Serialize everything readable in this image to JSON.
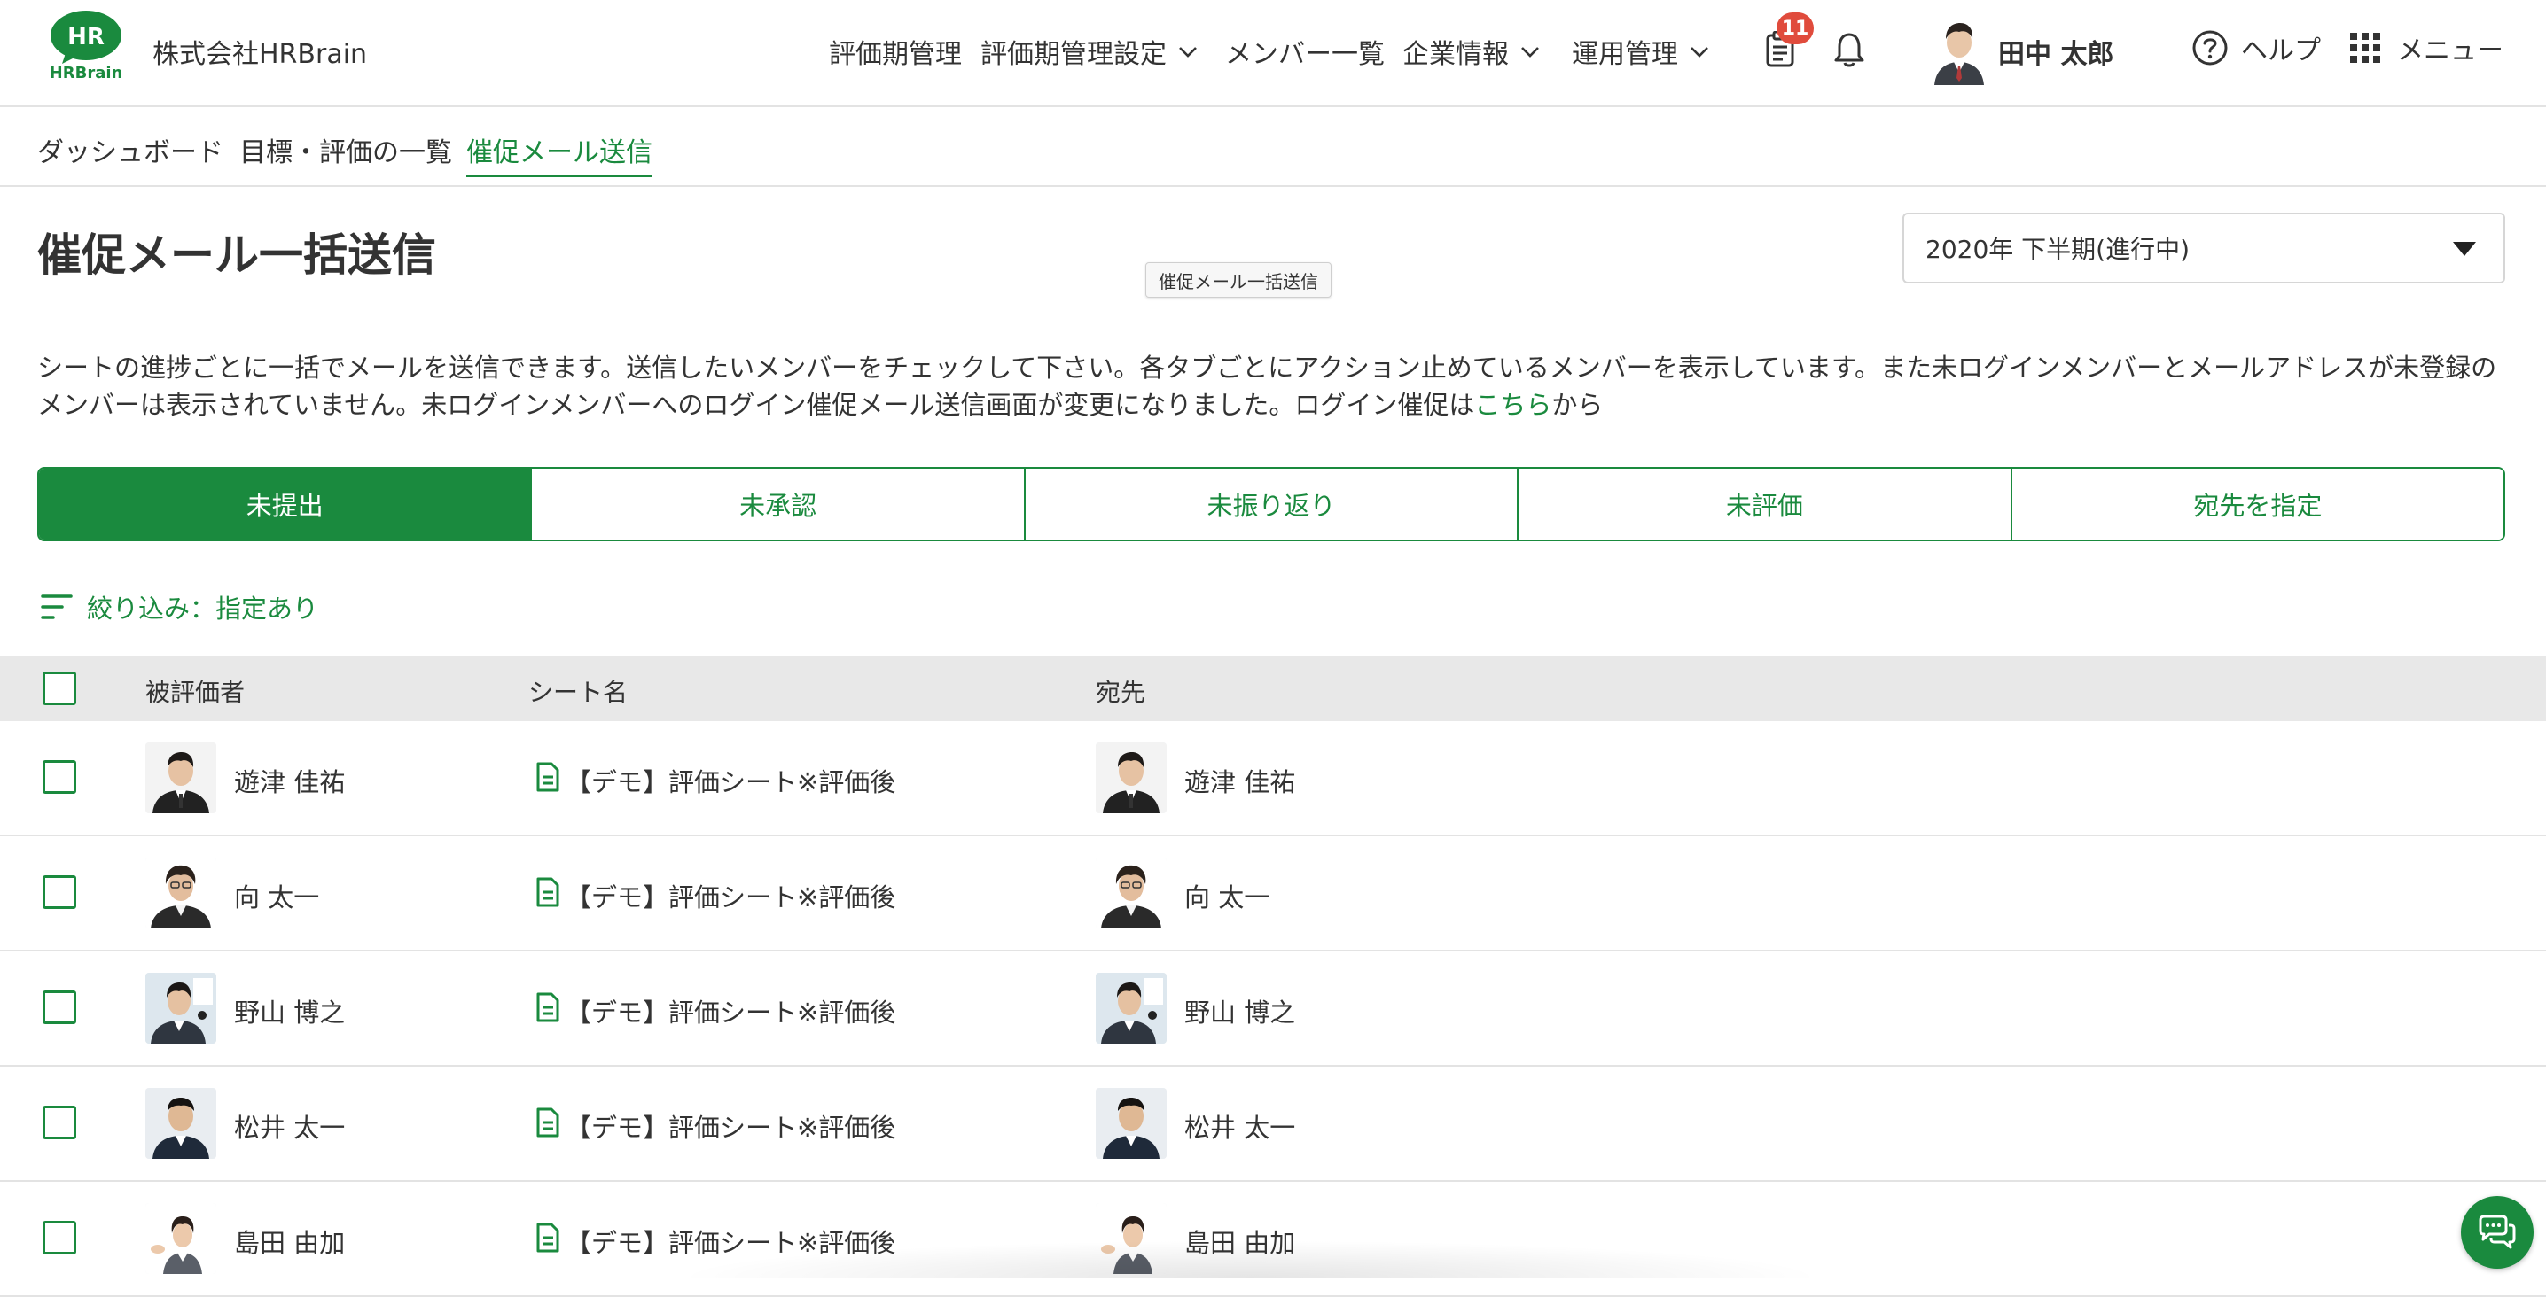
{
  "header": {
    "logo_text": "HR",
    "logo_subtext": "HRBrain",
    "company": "株式会社HRBrain",
    "nav": [
      {
        "label": "評価期管理",
        "dropdown": false
      },
      {
        "label": "評価期管理設定",
        "dropdown": true
      },
      {
        "label": "メンバー一覧",
        "dropdown": false
      },
      {
        "label": "企業情報",
        "dropdown": true
      },
      {
        "label": "運用管理",
        "dropdown": true
      }
    ],
    "notification_count": "11",
    "user_name": "田中 太郎",
    "help_label": "ヘルプ",
    "menu_label": "メニュー"
  },
  "subnav": [
    {
      "label": "ダッシュボード",
      "active": false
    },
    {
      "label": "目標・評価の一覧",
      "active": false
    },
    {
      "label": "催促メール送信",
      "active": true
    }
  ],
  "page": {
    "title": "催促メール一括送信",
    "tooltip": "催促メール一括送信",
    "period": "2020年 下半期(進行中)",
    "description": "シートの進捗ごとに一括でメールを送信できます。送信したいメンバーをチェックして下さい。各タブごとにアクション止めているメンバーを表示しています。また未ログインメンバーとメールアドレスが未登録のメンバーは表示されていません。未ログインメンバーへのログイン催促メール送信画面が変更になりました。ログイン催促は",
    "description_link": "こちら",
    "description_tail": "から"
  },
  "tabs": [
    {
      "label": "未提出",
      "active": true
    },
    {
      "label": "未承認",
      "active": false
    },
    {
      "label": "未振り返り",
      "active": false
    },
    {
      "label": "未評価",
      "active": false
    },
    {
      "label": "宛先を指定",
      "active": false
    }
  ],
  "filter_label": "絞り込み：指定あり",
  "table": {
    "headers": {
      "evaluatee": "被評価者",
      "sheet": "シート名",
      "recipient": "宛先"
    },
    "rows": [
      {
        "evaluatee": "遊津 佳祐",
        "sheet": "【デモ】評価シート※評価後",
        "recipient": "遊津 佳祐"
      },
      {
        "evaluatee": "向 太一",
        "sheet": "【デモ】評価シート※評価後",
        "recipient": "向 太一"
      },
      {
        "evaluatee": "野山 博之",
        "sheet": "【デモ】評価シート※評価後",
        "recipient": "野山 博之"
      },
      {
        "evaluatee": "松井 太一",
        "sheet": "【デモ】評価シート※評価後",
        "recipient": "松井 太一"
      },
      {
        "evaluatee": "島田 由加",
        "sheet": "【デモ】評価シート※評価後",
        "recipient": "島田 由加"
      }
    ]
  },
  "colors": {
    "accent": "#1a8a3e",
    "badge": "#e04b3c",
    "table_header_bg": "#e8e8e8"
  }
}
